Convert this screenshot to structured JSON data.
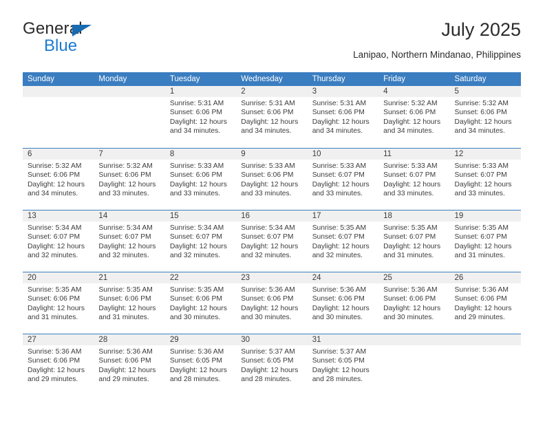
{
  "brand": {
    "name_top": "General",
    "name_bottom": "Blue",
    "color_blue": "#1a7ad1",
    "triangle_color": "#1a6bb0"
  },
  "header": {
    "title": "July 2025",
    "subtitle": "Lanipao, Northern Mindanao, Philippines"
  },
  "calendar": {
    "header_bg": "#3a7dc0",
    "daynum_bg": "#f0f0f0",
    "weekdays": [
      "Sunday",
      "Monday",
      "Tuesday",
      "Wednesday",
      "Thursday",
      "Friday",
      "Saturday"
    ],
    "weeks": [
      [
        {
          "day": "",
          "sunrise": "",
          "sunset": "",
          "daylight1": "",
          "daylight2": ""
        },
        {
          "day": "",
          "sunrise": "",
          "sunset": "",
          "daylight1": "",
          "daylight2": ""
        },
        {
          "day": "1",
          "sunrise": "Sunrise: 5:31 AM",
          "sunset": "Sunset: 6:06 PM",
          "daylight1": "Daylight: 12 hours",
          "daylight2": "and 34 minutes."
        },
        {
          "day": "2",
          "sunrise": "Sunrise: 5:31 AM",
          "sunset": "Sunset: 6:06 PM",
          "daylight1": "Daylight: 12 hours",
          "daylight2": "and 34 minutes."
        },
        {
          "day": "3",
          "sunrise": "Sunrise: 5:31 AM",
          "sunset": "Sunset: 6:06 PM",
          "daylight1": "Daylight: 12 hours",
          "daylight2": "and 34 minutes."
        },
        {
          "day": "4",
          "sunrise": "Sunrise: 5:32 AM",
          "sunset": "Sunset: 6:06 PM",
          "daylight1": "Daylight: 12 hours",
          "daylight2": "and 34 minutes."
        },
        {
          "day": "5",
          "sunrise": "Sunrise: 5:32 AM",
          "sunset": "Sunset: 6:06 PM",
          "daylight1": "Daylight: 12 hours",
          "daylight2": "and 34 minutes."
        }
      ],
      [
        {
          "day": "6",
          "sunrise": "Sunrise: 5:32 AM",
          "sunset": "Sunset: 6:06 PM",
          "daylight1": "Daylight: 12 hours",
          "daylight2": "and 34 minutes."
        },
        {
          "day": "7",
          "sunrise": "Sunrise: 5:32 AM",
          "sunset": "Sunset: 6:06 PM",
          "daylight1": "Daylight: 12 hours",
          "daylight2": "and 33 minutes."
        },
        {
          "day": "8",
          "sunrise": "Sunrise: 5:33 AM",
          "sunset": "Sunset: 6:06 PM",
          "daylight1": "Daylight: 12 hours",
          "daylight2": "and 33 minutes."
        },
        {
          "day": "9",
          "sunrise": "Sunrise: 5:33 AM",
          "sunset": "Sunset: 6:06 PM",
          "daylight1": "Daylight: 12 hours",
          "daylight2": "and 33 minutes."
        },
        {
          "day": "10",
          "sunrise": "Sunrise: 5:33 AM",
          "sunset": "Sunset: 6:07 PM",
          "daylight1": "Daylight: 12 hours",
          "daylight2": "and 33 minutes."
        },
        {
          "day": "11",
          "sunrise": "Sunrise: 5:33 AM",
          "sunset": "Sunset: 6:07 PM",
          "daylight1": "Daylight: 12 hours",
          "daylight2": "and 33 minutes."
        },
        {
          "day": "12",
          "sunrise": "Sunrise: 5:33 AM",
          "sunset": "Sunset: 6:07 PM",
          "daylight1": "Daylight: 12 hours",
          "daylight2": "and 33 minutes."
        }
      ],
      [
        {
          "day": "13",
          "sunrise": "Sunrise: 5:34 AM",
          "sunset": "Sunset: 6:07 PM",
          "daylight1": "Daylight: 12 hours",
          "daylight2": "and 32 minutes."
        },
        {
          "day": "14",
          "sunrise": "Sunrise: 5:34 AM",
          "sunset": "Sunset: 6:07 PM",
          "daylight1": "Daylight: 12 hours",
          "daylight2": "and 32 minutes."
        },
        {
          "day": "15",
          "sunrise": "Sunrise: 5:34 AM",
          "sunset": "Sunset: 6:07 PM",
          "daylight1": "Daylight: 12 hours",
          "daylight2": "and 32 minutes."
        },
        {
          "day": "16",
          "sunrise": "Sunrise: 5:34 AM",
          "sunset": "Sunset: 6:07 PM",
          "daylight1": "Daylight: 12 hours",
          "daylight2": "and 32 minutes."
        },
        {
          "day": "17",
          "sunrise": "Sunrise: 5:35 AM",
          "sunset": "Sunset: 6:07 PM",
          "daylight1": "Daylight: 12 hours",
          "daylight2": "and 32 minutes."
        },
        {
          "day": "18",
          "sunrise": "Sunrise: 5:35 AM",
          "sunset": "Sunset: 6:07 PM",
          "daylight1": "Daylight: 12 hours",
          "daylight2": "and 31 minutes."
        },
        {
          "day": "19",
          "sunrise": "Sunrise: 5:35 AM",
          "sunset": "Sunset: 6:07 PM",
          "daylight1": "Daylight: 12 hours",
          "daylight2": "and 31 minutes."
        }
      ],
      [
        {
          "day": "20",
          "sunrise": "Sunrise: 5:35 AM",
          "sunset": "Sunset: 6:06 PM",
          "daylight1": "Daylight: 12 hours",
          "daylight2": "and 31 minutes."
        },
        {
          "day": "21",
          "sunrise": "Sunrise: 5:35 AM",
          "sunset": "Sunset: 6:06 PM",
          "daylight1": "Daylight: 12 hours",
          "daylight2": "and 31 minutes."
        },
        {
          "day": "22",
          "sunrise": "Sunrise: 5:35 AM",
          "sunset": "Sunset: 6:06 PM",
          "daylight1": "Daylight: 12 hours",
          "daylight2": "and 30 minutes."
        },
        {
          "day": "23",
          "sunrise": "Sunrise: 5:36 AM",
          "sunset": "Sunset: 6:06 PM",
          "daylight1": "Daylight: 12 hours",
          "daylight2": "and 30 minutes."
        },
        {
          "day": "24",
          "sunrise": "Sunrise: 5:36 AM",
          "sunset": "Sunset: 6:06 PM",
          "daylight1": "Daylight: 12 hours",
          "daylight2": "and 30 minutes."
        },
        {
          "day": "25",
          "sunrise": "Sunrise: 5:36 AM",
          "sunset": "Sunset: 6:06 PM",
          "daylight1": "Daylight: 12 hours",
          "daylight2": "and 30 minutes."
        },
        {
          "day": "26",
          "sunrise": "Sunrise: 5:36 AM",
          "sunset": "Sunset: 6:06 PM",
          "daylight1": "Daylight: 12 hours",
          "daylight2": "and 29 minutes."
        }
      ],
      [
        {
          "day": "27",
          "sunrise": "Sunrise: 5:36 AM",
          "sunset": "Sunset: 6:06 PM",
          "daylight1": "Daylight: 12 hours",
          "daylight2": "and 29 minutes."
        },
        {
          "day": "28",
          "sunrise": "Sunrise: 5:36 AM",
          "sunset": "Sunset: 6:06 PM",
          "daylight1": "Daylight: 12 hours",
          "daylight2": "and 29 minutes."
        },
        {
          "day": "29",
          "sunrise": "Sunrise: 5:36 AM",
          "sunset": "Sunset: 6:05 PM",
          "daylight1": "Daylight: 12 hours",
          "daylight2": "and 28 minutes."
        },
        {
          "day": "30",
          "sunrise": "Sunrise: 5:37 AM",
          "sunset": "Sunset: 6:05 PM",
          "daylight1": "Daylight: 12 hours",
          "daylight2": "and 28 minutes."
        },
        {
          "day": "31",
          "sunrise": "Sunrise: 5:37 AM",
          "sunset": "Sunset: 6:05 PM",
          "daylight1": "Daylight: 12 hours",
          "daylight2": "and 28 minutes."
        },
        {
          "day": "",
          "sunrise": "",
          "sunset": "",
          "daylight1": "",
          "daylight2": ""
        },
        {
          "day": "",
          "sunrise": "",
          "sunset": "",
          "daylight1": "",
          "daylight2": ""
        }
      ]
    ]
  }
}
